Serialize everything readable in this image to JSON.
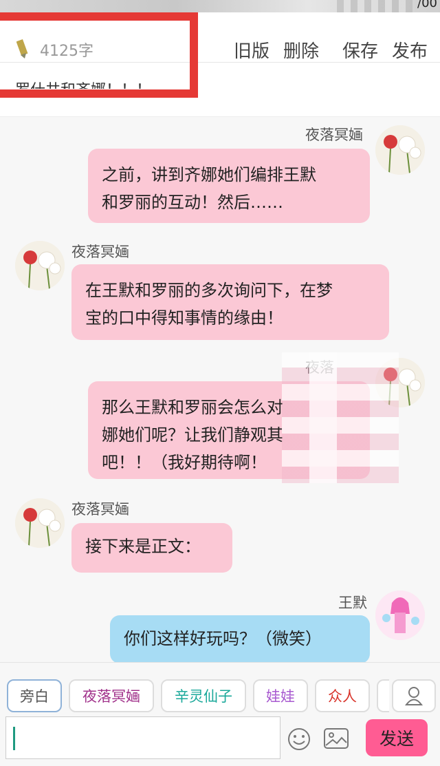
{
  "status_bar": {
    "clock_fragment": "/00"
  },
  "header": {
    "word_count": "4125字",
    "actions": {
      "old_version": "旧版",
      "delete": "删除",
      "save": "保存",
      "publish": "发布"
    }
  },
  "title": {
    "text": "罗什井和齐娜！！！"
  },
  "messages": [
    {
      "name": "夜落冥婳",
      "side": "right",
      "lines": [
        "之前，讲到齐娜她们编排王默",
        "和罗丽的互动！然后……"
      ]
    },
    {
      "name": "夜落冥婳",
      "side": "left",
      "lines": [
        "在王默和罗丽的多次询问下，在梦",
        "宝的口中得知事情的缘由！"
      ]
    },
    {
      "name": "夜落",
      "side": "right",
      "lines": [
        "那么王默和罗丽会怎么对",
        "娜她们呢？让我们静观其",
        "吧！！（我好期待啊！"
      ]
    },
    {
      "name": "夜落冥婳",
      "side": "left",
      "lines": [
        "接下来是正文："
      ]
    },
    {
      "name": "王默",
      "side": "right",
      "lines": [
        "你们这样好玩吗？（微笑）"
      ]
    }
  ],
  "roles": [
    {
      "label": "旁白",
      "color": "#555555"
    },
    {
      "label": "夜落冥婳",
      "color": "#a0308a"
    },
    {
      "label": "辛灵仙子",
      "color": "#1aa89a"
    },
    {
      "label": "娃娃",
      "color": "#a85ad0"
    },
    {
      "label": "众人",
      "color": "#d9342b"
    }
  ],
  "composer": {
    "send_label": "发送",
    "value": ""
  },
  "icons": {
    "pencil": "pencil-icon",
    "avatar_flower": "red-spider-lily-avatar",
    "avatar_wangmo": "wangmo-avatar",
    "contacts": "person-icon",
    "emoji": "smiley-icon",
    "image": "image-icon"
  },
  "colors": {
    "bubble_pink": "#fbc8d5",
    "bubble_blue": "#a7dcf4",
    "send_button": "#ff5c93",
    "annotation_red": "#e53935"
  }
}
